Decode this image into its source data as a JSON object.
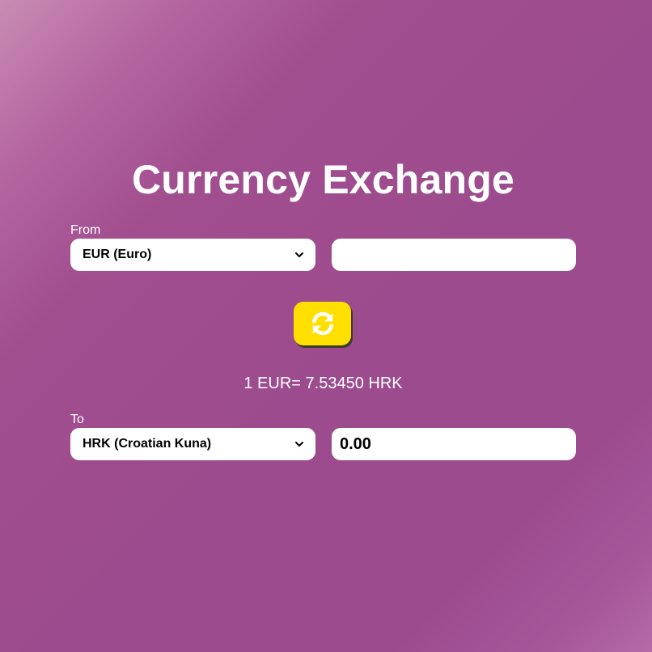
{
  "app": {
    "title": "Currency Exchange"
  },
  "from": {
    "label": "From",
    "currency": "EUR (Euro)",
    "amount": "",
    "placeholder": ""
  },
  "to": {
    "label": "To",
    "currency": "HRK (Croatian Kuna)",
    "amount": "0.00"
  },
  "rate": {
    "text": "1 EUR= 7.53450 HRK"
  },
  "swap": {
    "icon": "refresh-icon",
    "color": "#ffe000"
  },
  "colors": {
    "background": "#9c4b8e",
    "accent": "#ffe000",
    "text": "#ffffff"
  }
}
